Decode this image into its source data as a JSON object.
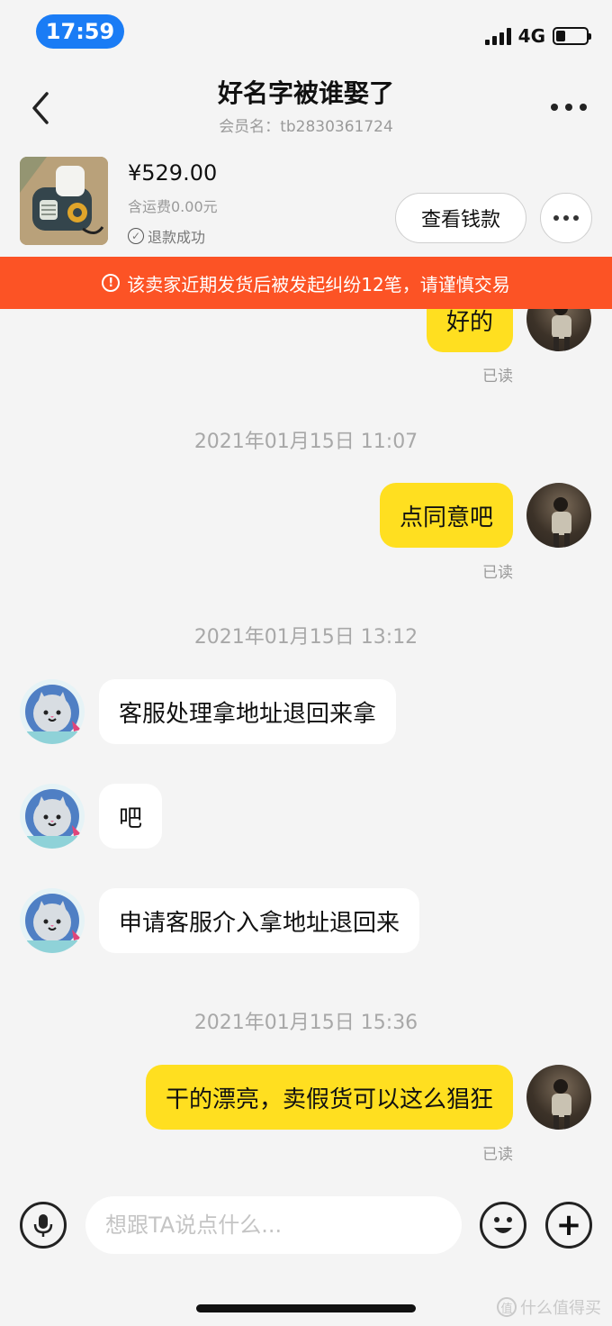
{
  "status_bar": {
    "time": "17:59",
    "network": "4G",
    "battery_level": 0.3
  },
  "header": {
    "title": "好名字被谁娶了",
    "member_label": "会员名：",
    "member_id": "tb2830361724"
  },
  "product": {
    "price": "¥529.00",
    "shipping": "含运费0.00元",
    "refund_status": "退款成功",
    "view_button": "查看钱款"
  },
  "warning": {
    "text": "该卖家近期发货后被发起纠纷12笔，请谨慎交易"
  },
  "messages": [
    {
      "type": "out",
      "text": "好的",
      "status": "已读"
    },
    {
      "type": "time",
      "text": "2021年01月15日 11:07"
    },
    {
      "type": "out",
      "text": "点同意吧",
      "status": "已读"
    },
    {
      "type": "time",
      "text": "2021年01月15日 13:12"
    },
    {
      "type": "in",
      "text": "客服处理拿地址退回来拿"
    },
    {
      "type": "in",
      "text": "吧"
    },
    {
      "type": "in",
      "text": "申请客服介入拿地址退回来"
    },
    {
      "type": "time",
      "text": "2021年01月15日 15:36"
    },
    {
      "type": "out",
      "text": "干的漂亮，卖假货可以这么猖狂",
      "status": "已读"
    }
  ],
  "input_bar": {
    "placeholder": "想跟TA说点什么..."
  },
  "watermark": {
    "text": "什么值得买",
    "logo_glyph": "值"
  },
  "colors": {
    "accent_bubble": "#ffdf20",
    "warning": "#fc5325",
    "time_pill": "#1a7cf5"
  }
}
